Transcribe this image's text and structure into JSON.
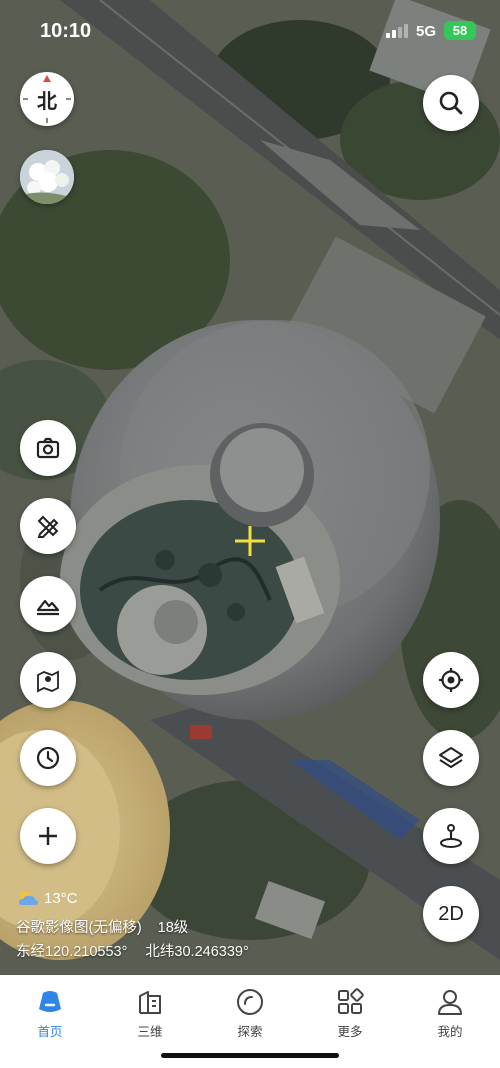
{
  "status_bar": {
    "time": "10:10",
    "network": "5G",
    "battery": "58"
  },
  "map": {
    "compass_label": "北",
    "weather": {
      "temperature": "13°C"
    },
    "layer_info": {
      "source": "谷歌影像图(无偏移)",
      "zoom_level": "18级"
    },
    "coordinates": {
      "longitude": "东经120.210553°",
      "latitude": "北纬30.246339°"
    },
    "view_mode_label": "2D"
  },
  "tabs": [
    {
      "label": "首页",
      "active": true
    },
    {
      "label": "三维",
      "active": false
    },
    {
      "label": "探索",
      "active": false
    },
    {
      "label": "更多",
      "active": false
    },
    {
      "label": "我的",
      "active": false
    }
  ],
  "colors": {
    "accent": "#2f86e8",
    "battery": "#34c759"
  }
}
